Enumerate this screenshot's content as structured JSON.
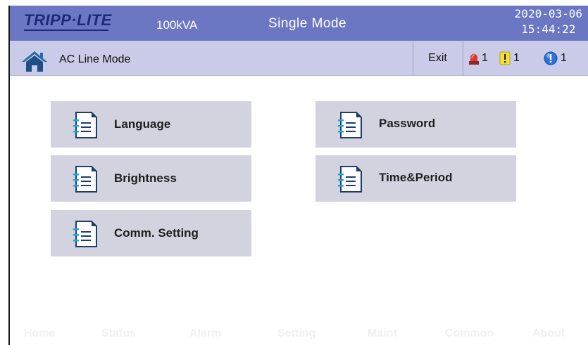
{
  "header": {
    "logo": "TRIPP·LITE",
    "rating": "100kVA",
    "mode": "Single Mode",
    "date": "2020-03-06",
    "time": "15:44:22"
  },
  "status": {
    "mode_text": "AC Line Mode",
    "exit_label": "Exit",
    "alarms": [
      {
        "icon": "red-alarm-light-icon",
        "count": "1"
      },
      {
        "icon": "yellow-warning-icon",
        "count": "1"
      },
      {
        "icon": "blue-info-icon",
        "count": "1"
      }
    ]
  },
  "menu": {
    "items": [
      {
        "label": "Language"
      },
      {
        "label": "Password"
      },
      {
        "label": "Brightness"
      },
      {
        "label": "Time&Period"
      },
      {
        "label": "Comm. Setting"
      }
    ]
  },
  "footer": {
    "tabs": [
      {
        "label": "Home"
      },
      {
        "label": "Status"
      },
      {
        "label": "Alarm"
      },
      {
        "label": "Setting"
      },
      {
        "label": "Maint"
      },
      {
        "label": "Common"
      },
      {
        "label": "About"
      }
    ]
  },
  "colors": {
    "header_bg": "#6b77c2",
    "status_bg": "#c9cbe8",
    "button_bg": "#d2d3de",
    "logo": "#1c2a7a"
  }
}
